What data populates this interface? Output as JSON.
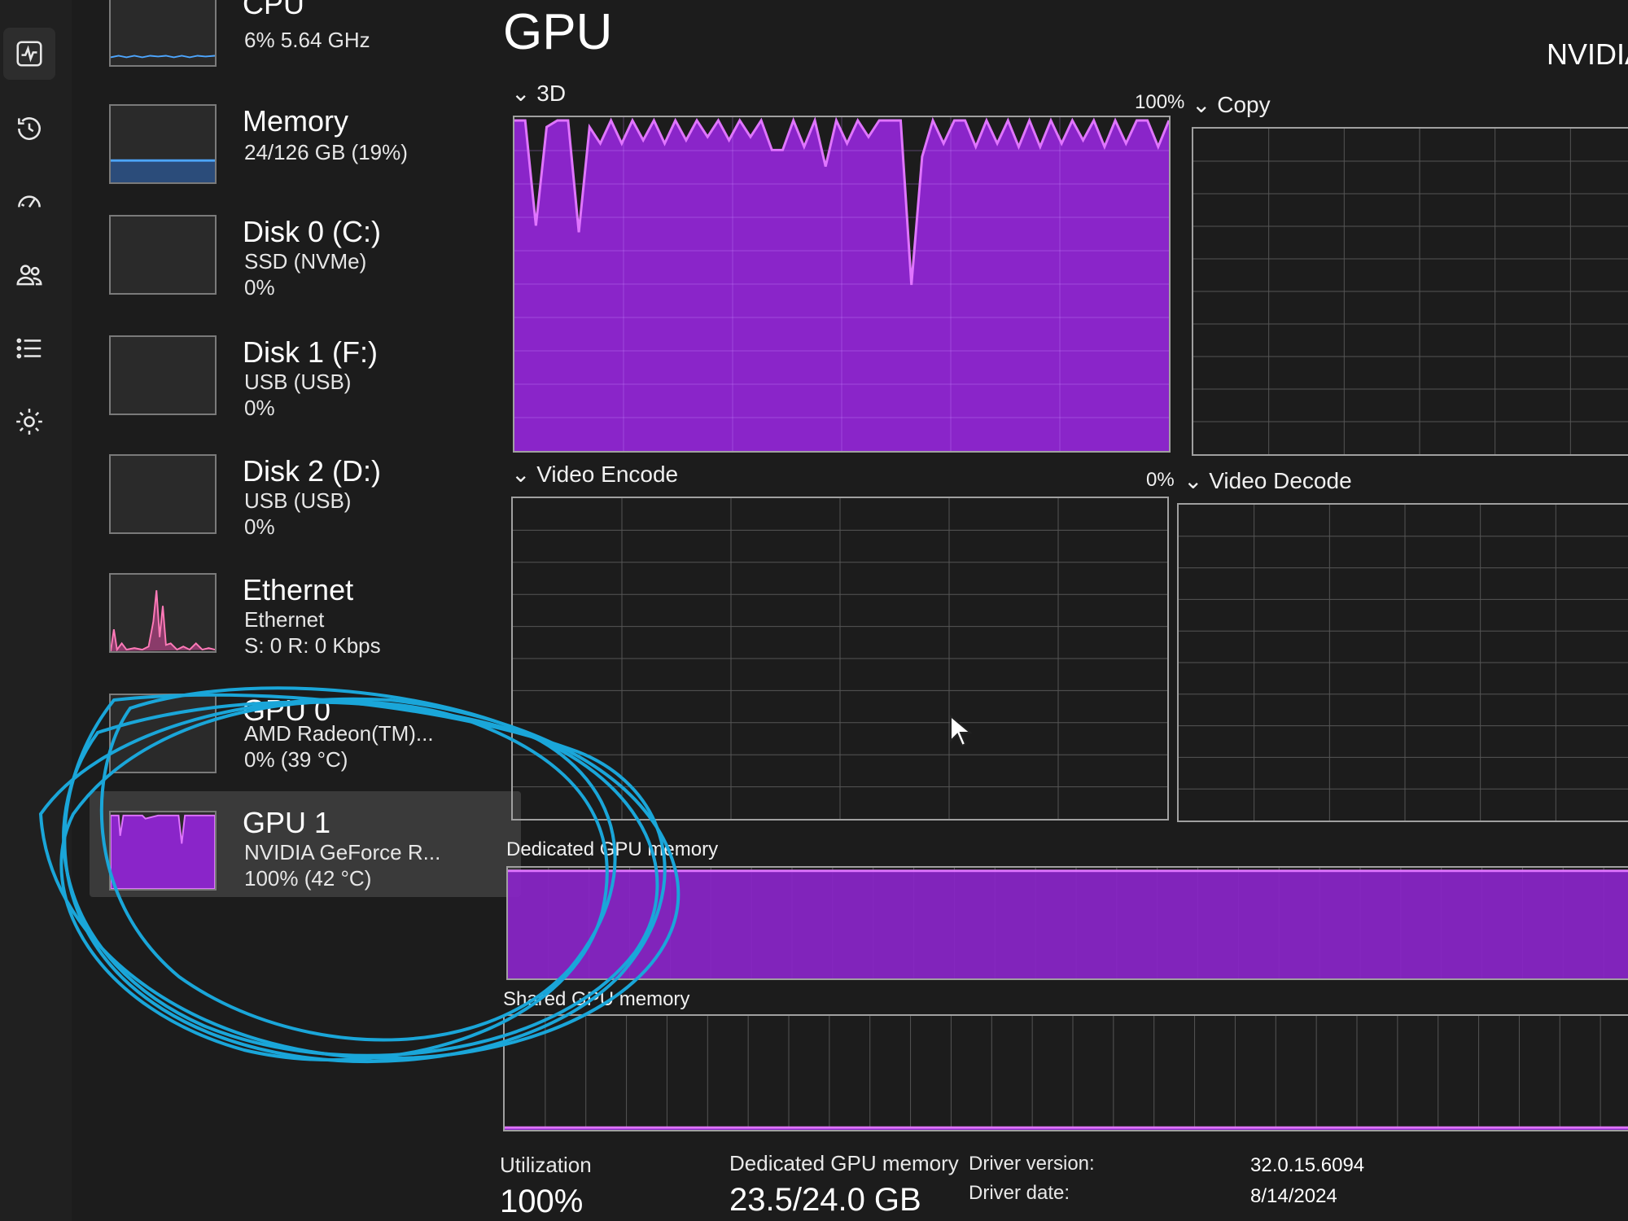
{
  "colors": {
    "accent": "#8a25c9",
    "accent_line": "#e075ff",
    "annotation": "#1aa6d9"
  },
  "sidebar_icons": [
    "performance-icon",
    "app-history-icon",
    "startup-apps-icon",
    "users-icon",
    "details-icon",
    "services-icon"
  ],
  "devices": [
    {
      "name": "CPU",
      "line1": "6% 5.64 GHz",
      "line2": ""
    },
    {
      "name": "Memory",
      "line1": "24/126 GB (19%)",
      "line2": ""
    },
    {
      "name": "Disk 0 (C:)",
      "line1": "SSD (NVMe)",
      "line2": "0%"
    },
    {
      "name": "Disk 1 (F:)",
      "line1": "USB (USB)",
      "line2": "0%"
    },
    {
      "name": "Disk 2 (D:)",
      "line1": "USB (USB)",
      "line2": "0%"
    },
    {
      "name": "Ethernet",
      "line1": "Ethernet",
      "line2": "S: 0 R: 0 Kbps"
    },
    {
      "name": "GPU 0",
      "line1": "AMD Radeon(TM)...",
      "line2": "0% (39 °C)"
    },
    {
      "name": "GPU 1",
      "line1": "NVIDIA GeForce R...",
      "line2": "100% (42 °C)"
    }
  ],
  "main": {
    "title": "GPU",
    "model": "NVIDIA",
    "engines": [
      {
        "label": "3D",
        "percent": "100%"
      },
      {
        "label": "Copy",
        "percent": ""
      },
      {
        "label": "Video Encode",
        "percent": "0%"
      },
      {
        "label": "Video Decode",
        "percent": ""
      }
    ],
    "dedicated_label": "Dedicated GPU memory",
    "shared_label": "Shared GPU memory",
    "dedicated_fill_fraction": 0.979,
    "shared_fill_fraction": 0.02,
    "three_d_usage": [
      100,
      100,
      68,
      98,
      100,
      100,
      66,
      98,
      93,
      100,
      93,
      100,
      94,
      100,
      93,
      100,
      94,
      100,
      95,
      100,
      94,
      100,
      95,
      100,
      91,
      91,
      100,
      92,
      100,
      86,
      100,
      93,
      100,
      95,
      100,
      100,
      100,
      50,
      89,
      100,
      93,
      100,
      100,
      92,
      100,
      93,
      100,
      92,
      100,
      92,
      100,
      93,
      100,
      94,
      100,
      92,
      100,
      93,
      100,
      100,
      92,
      100
    ]
  },
  "stats": {
    "utilization_label": "Utilization",
    "utilization_value": "100%",
    "dedicated_label": "Dedicated GPU memory",
    "dedicated_value": "23.5/24.0 GB",
    "driver_version_label": "Driver version:",
    "driver_version_value": "32.0.15.6094",
    "driver_date_label": "Driver date:",
    "driver_date_value": "8/14/2024"
  }
}
